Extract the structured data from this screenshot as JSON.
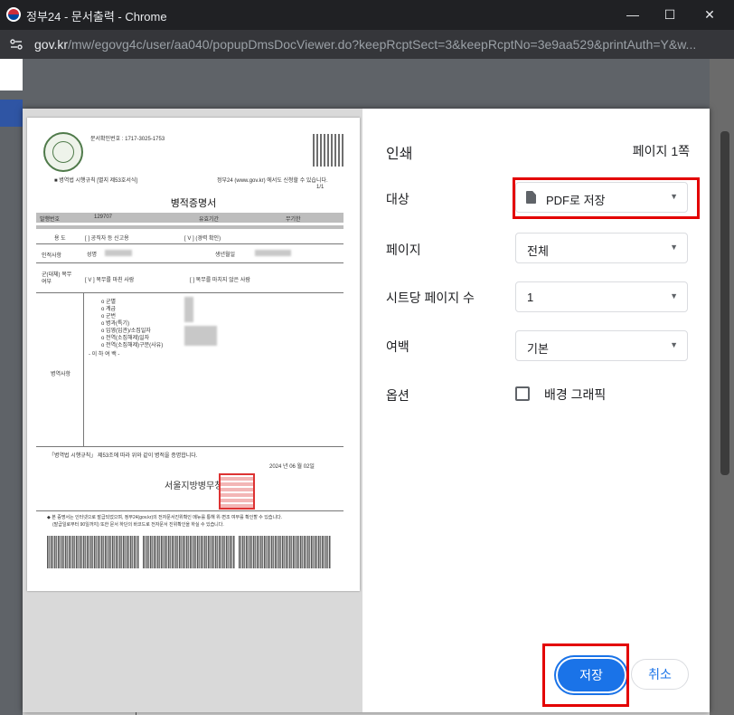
{
  "window": {
    "title": "정부24 - 문서출력 - Chrome",
    "controls": {
      "minimize": "—",
      "maximize": "☐",
      "close": "✕"
    }
  },
  "address": {
    "host": "gov.kr",
    "path": "/mw/egovg4c/user/aa040/popupDmsDocViewer.do?keepRcptSect=3&keepRcptNo=3e9aa529&printAuth=Y&w..."
  },
  "preview": {
    "doc_confirm": "문서확인번호 : 1717-3025-1753",
    "form_note": "■ 병역법 시행규칙 [별지 제53호서식]",
    "source_note": "정부24 (www.gov.kr) 에서도 신청할 수 있습니다.",
    "page_fraction": "1/1",
    "doc_title": "병적증명서",
    "issue_no_label": "발행번호",
    "issue_no": "129707",
    "validity_label": "유효기간",
    "validity_value": "무기한",
    "purpose_label": "용 도",
    "purpose_opt1": "[ ] 공직자 등 신고용",
    "purpose_opt2": "[ V ] (경력 확인)",
    "person_label": "인적사항",
    "name_label": "성명",
    "birth_label": "생년월일",
    "service_label": "군(대체) 복무 여부",
    "service_yes": "[ V ] 복무를 마친 사람",
    "service_no": "[ ] 복무를 마치지 않은 사람",
    "record_label": "병역사항",
    "record_items": [
      "o 군별",
      "o 계급",
      "o 군번",
      "o 병과(특기)",
      "o 입영(입관)/소집일자",
      "o 전역(소집해제)일자",
      "o 전역(소집해제)구분(사유)",
      "- 이 하 여 백 -"
    ],
    "certify_text": "「병역법 시행규칙」 제53조에 따라 위와 같이 병적을 증명합니다.",
    "date_text": "2024 년 06 월 02일",
    "issuer": "서울지방병무청장",
    "footer_note": "◆ 본 증명서는 인터넷으로 발급되었으며, 정부24(gov.kr)의 전자문서진위확인 메뉴를 통해 위·변조 여부를 확인할 수 있습니다.",
    "footer_note2": "(발급일로부터 90일까지) 또한 문서 하단의 바코드로 전자문서 진위확인을 하실 수 있습니다."
  },
  "print": {
    "heading": "인쇄",
    "page_count": "페이지 1쪽",
    "destination_label": "대상",
    "destination_value": "PDF로 저장",
    "pages_label": "페이지",
    "pages_value": "전체",
    "pages_per_sheet_label": "시트당 페이지 수",
    "pages_per_sheet_value": "1",
    "margins_label": "여백",
    "margins_value": "기본",
    "options_label": "옵션",
    "background_graphics_label": "배경 그래픽",
    "background_graphics_checked": false,
    "save_label": "저장",
    "cancel_label": "취소"
  },
  "colors": {
    "accent": "#1a73e8",
    "highlight": "#e30000"
  }
}
